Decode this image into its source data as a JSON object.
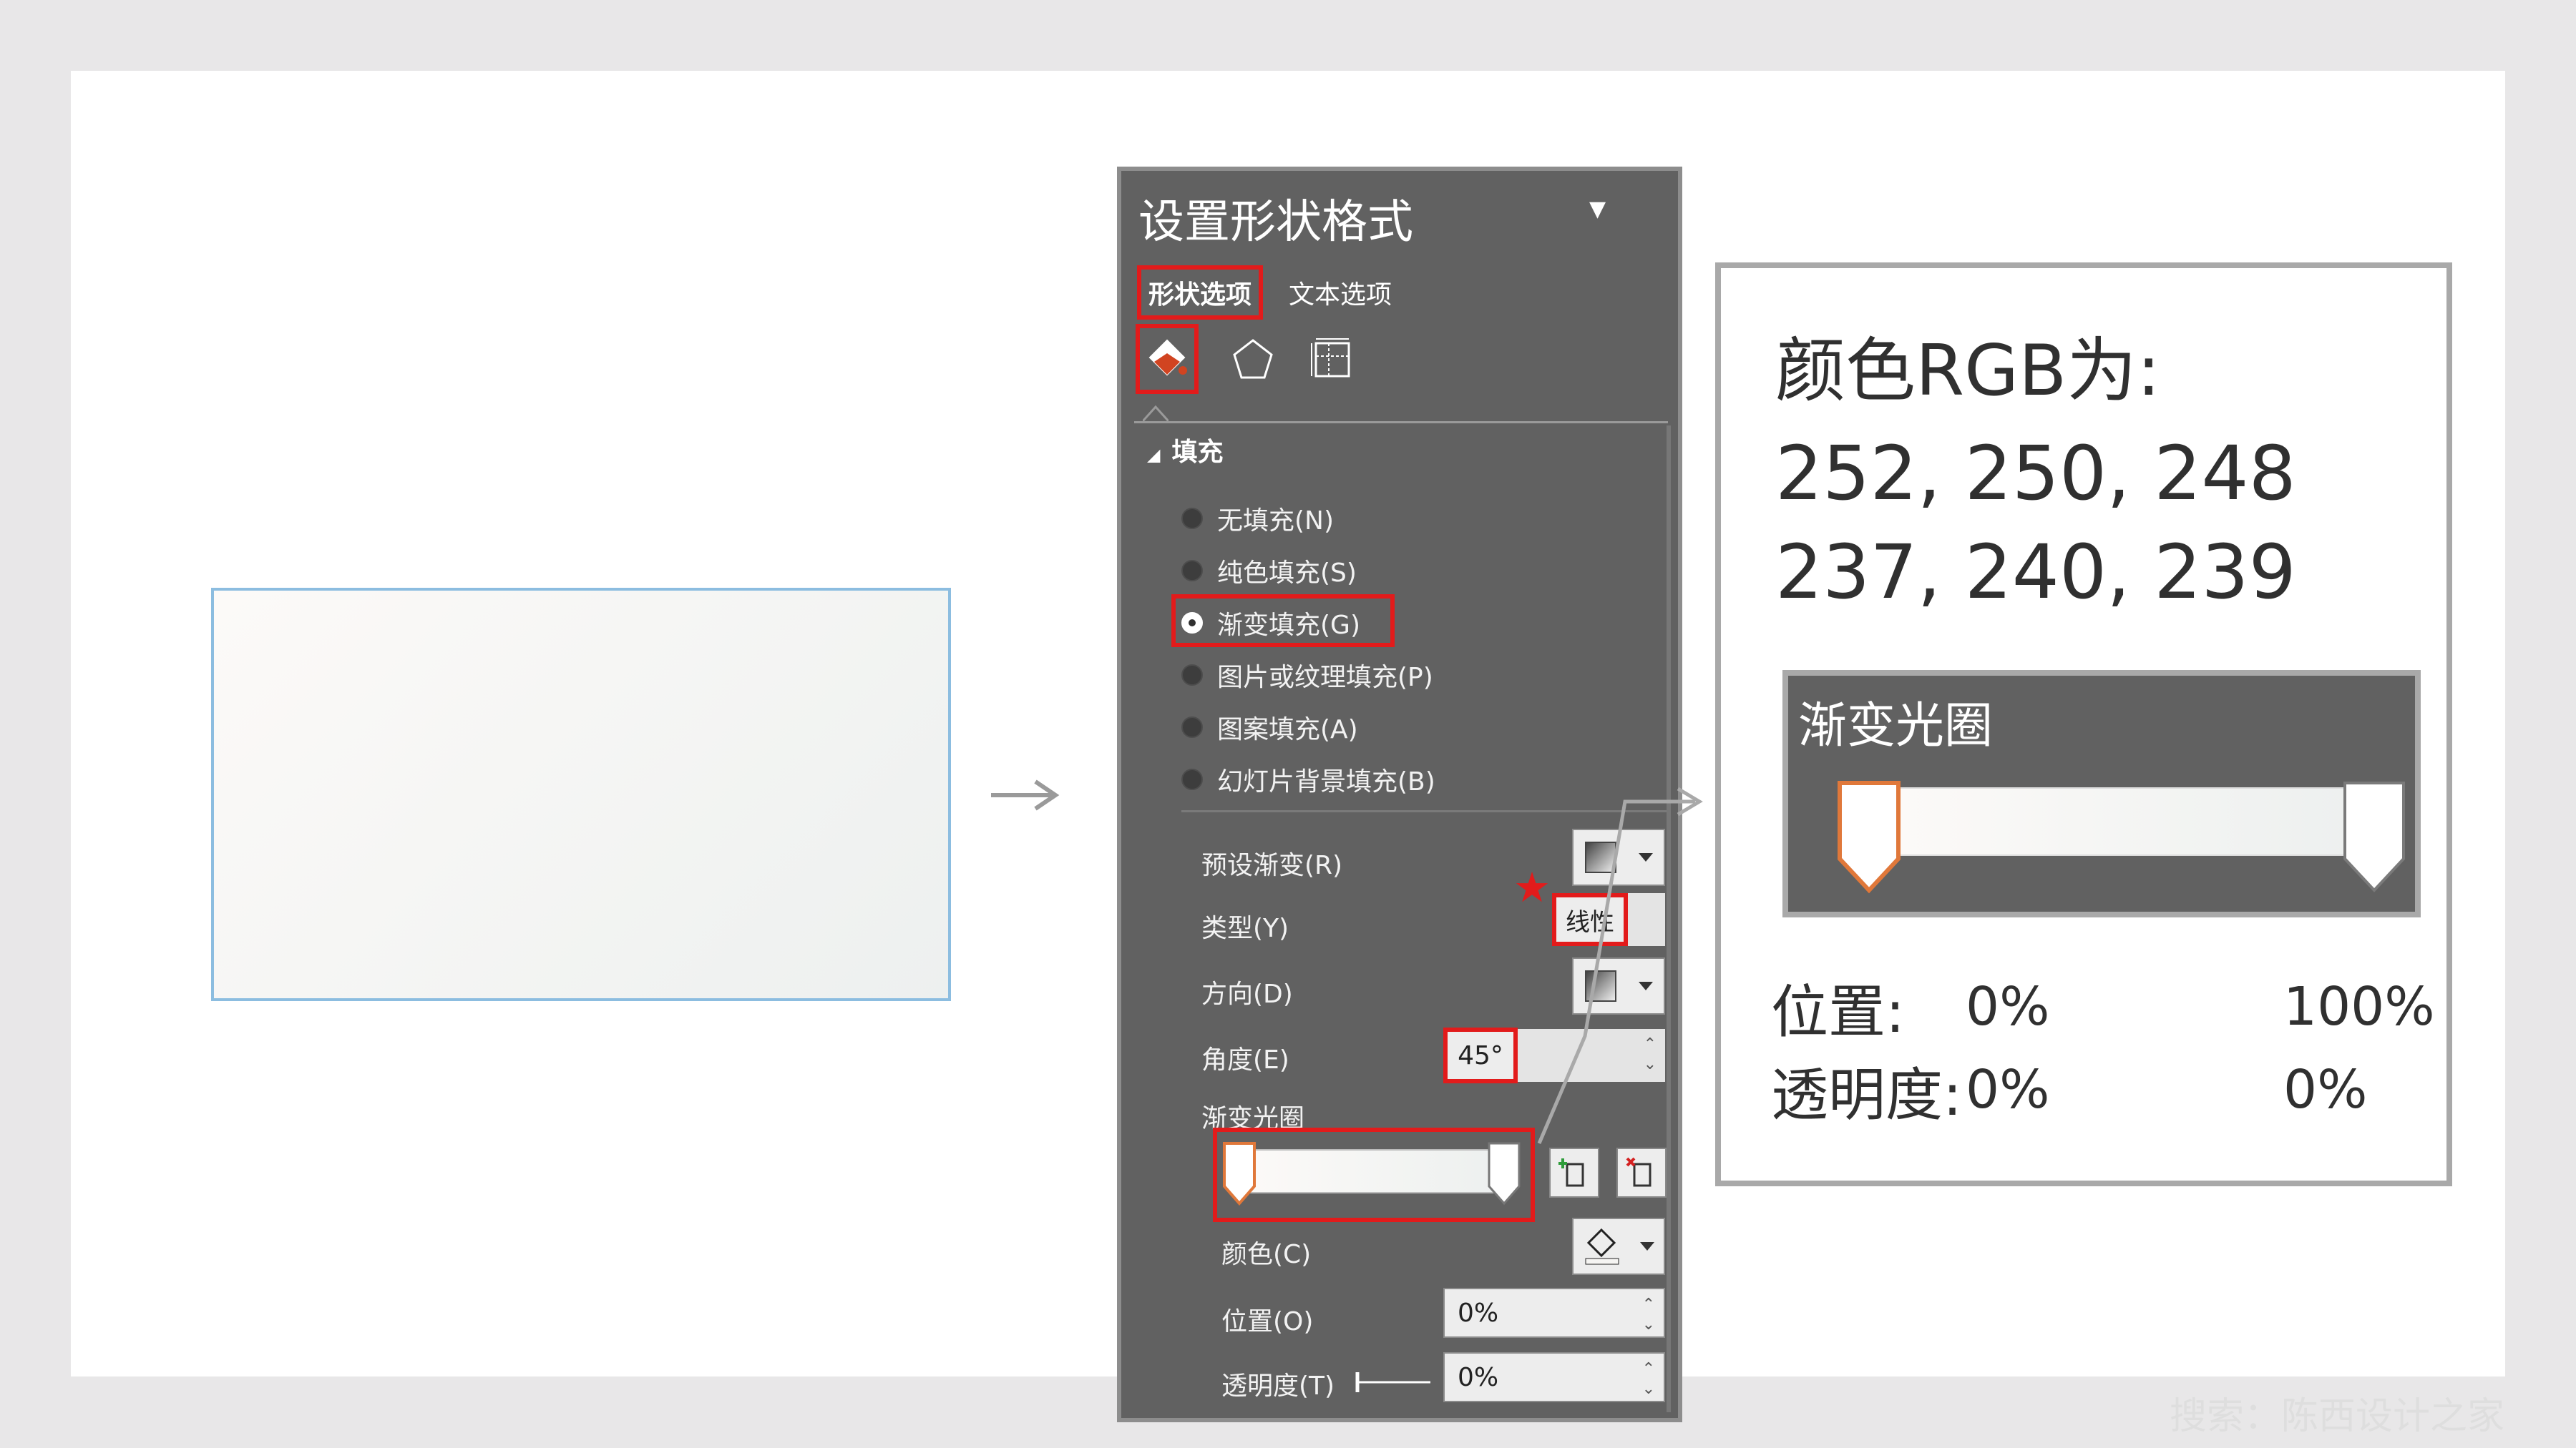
{
  "panel": {
    "title": "设置形状格式",
    "tabs": {
      "shape_options": "形状选项",
      "text_options": "文本选项"
    },
    "section_fill": "填充",
    "fill_options": [
      {
        "label": "无填充(N)",
        "selected": false
      },
      {
        "label": "纯色填充(S)",
        "selected": false
      },
      {
        "label": "渐变填充(G)",
        "selected": true
      },
      {
        "label": "图片或纹理填充(P)",
        "selected": false
      },
      {
        "label": "图案填充(A)",
        "selected": false
      },
      {
        "label": "幻灯片背景填充(B)",
        "selected": false
      }
    ],
    "preset_gradient_label": "预设渐变(R)",
    "type_label": "类型(Y)",
    "type_value": "线性",
    "direction_label": "方向(D)",
    "angle_label": "角度(E)",
    "angle_value": "45°",
    "gradient_stops_label": "渐变光圈",
    "color_label": "颜色(C)",
    "position_label": "位置(O)",
    "position_value": "0%",
    "transparency_label": "透明度(T)",
    "transparency_value": "0%"
  },
  "callout": {
    "title": "颜色RGB为:",
    "rgb_start": "252, 250, 248",
    "rgb_end": "237, 240, 239",
    "gradient_stops_title": "渐变光圈",
    "position_label": "位置:",
    "transparency_label": "透明度:",
    "stop_left_position": "0%",
    "stop_right_position": "100%",
    "stop_left_transparency": "0%",
    "stop_right_transparency": "0%"
  },
  "gradient": {
    "start_color": "#fcfaf8",
    "end_color": "#edf0ef",
    "angle_deg": 45
  },
  "colors": {
    "highlight": "#e21b1b",
    "panel_bg": "#616161",
    "preview_border": "#8cbde0"
  },
  "watermark": "搜索：陈西设计之家"
}
